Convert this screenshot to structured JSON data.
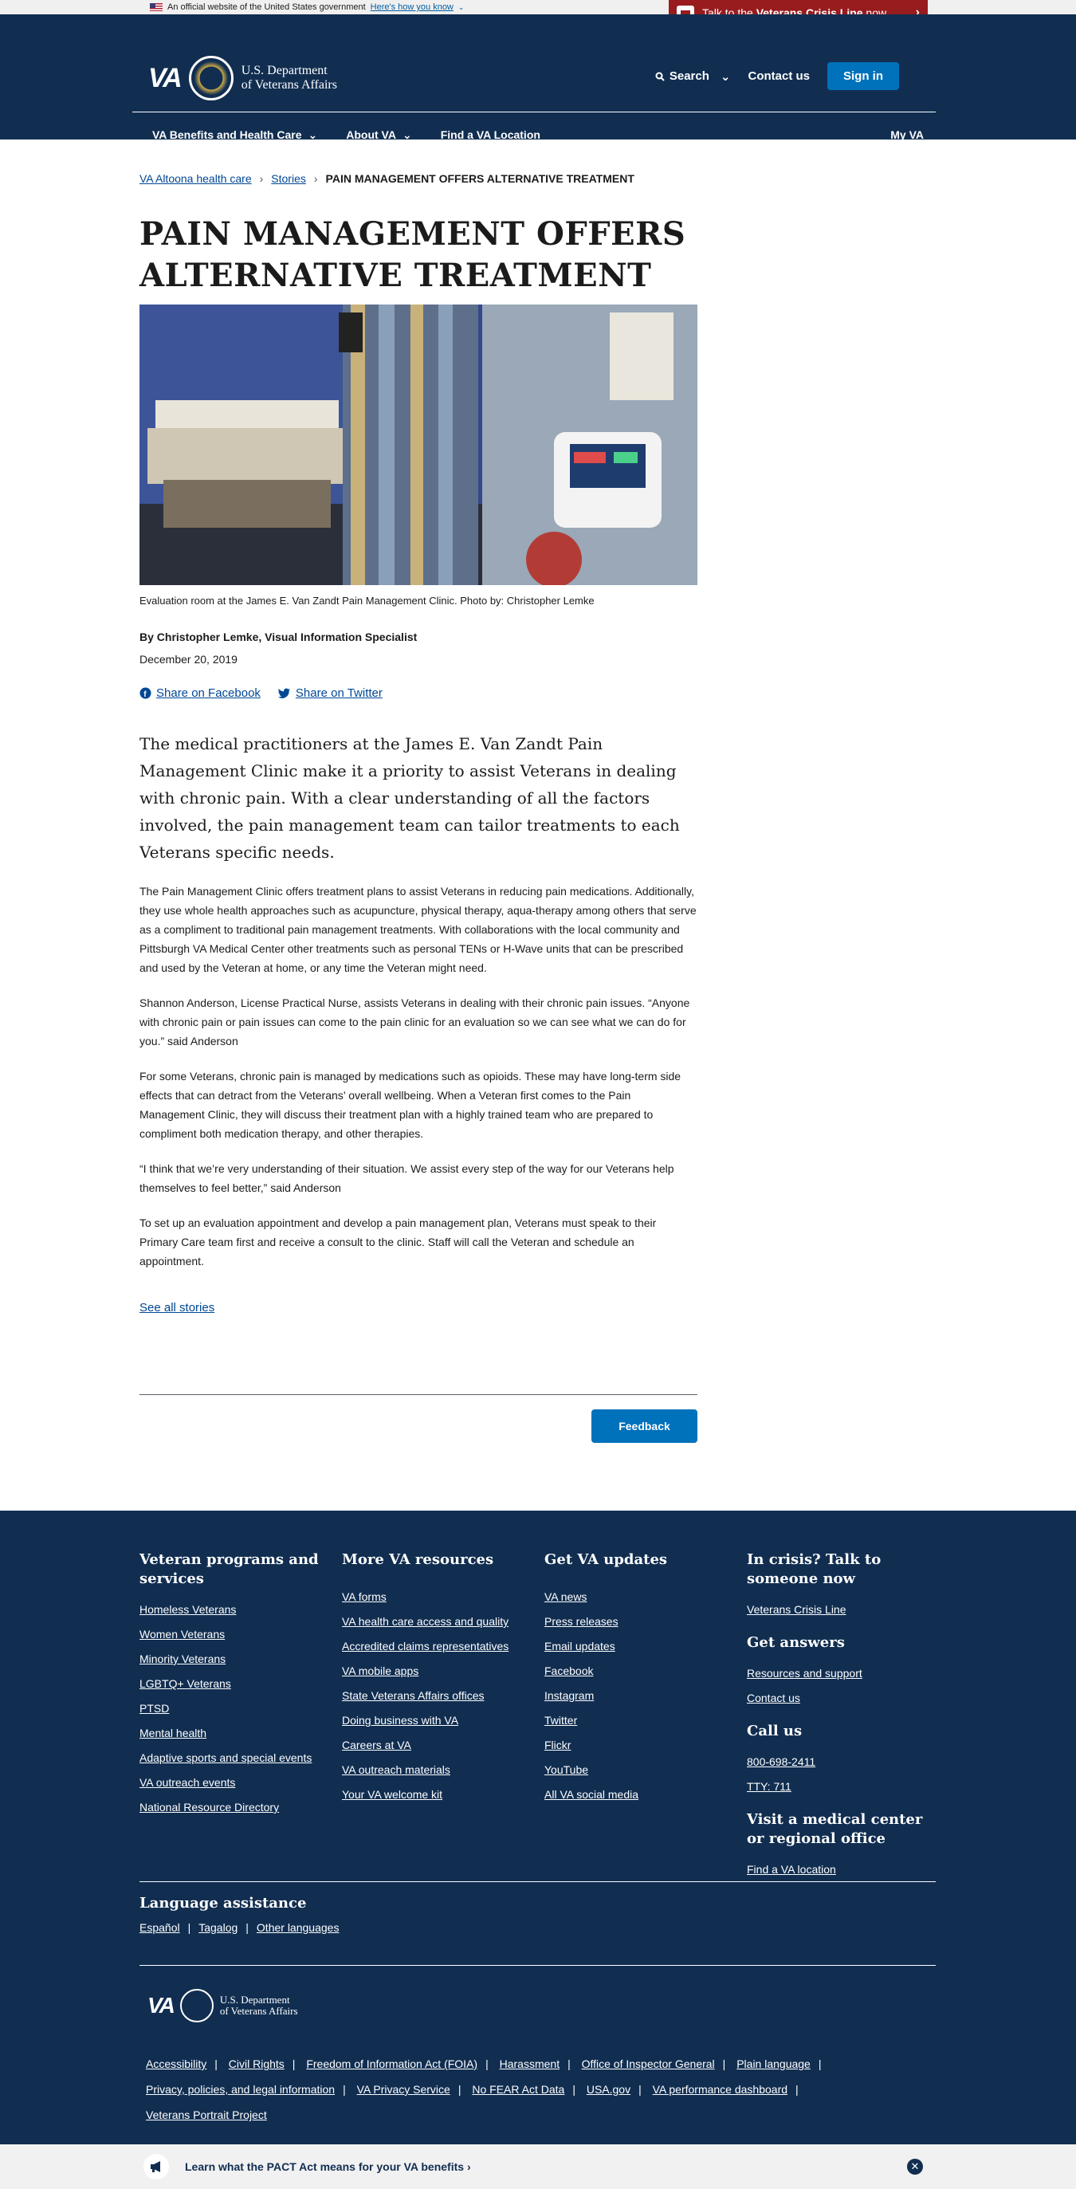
{
  "official_banner": {
    "text": "An official website of the United States government",
    "link": "Here's how you know"
  },
  "crisis_line": {
    "prefix": "Talk to the ",
    "strong": "Veterans Crisis Line",
    "suffix": " now"
  },
  "header": {
    "logo_text": "VA",
    "dept_line1": "U.S. Department",
    "dept_line2": "of Veterans Affairs",
    "search": "Search",
    "contact": "Contact us",
    "signin": "Sign in",
    "nav": [
      "VA Benefits and Health Care",
      "About VA",
      "Find a VA Location"
    ],
    "my_va": "My VA"
  },
  "breadcrumb": {
    "items": [
      "VA Altoona health care",
      "Stories"
    ],
    "current": "PAIN MANAGEMENT OFFERS ALTERNATIVE TREATMENT"
  },
  "article": {
    "title_line1": "PAIN MANAGEMENT OFFERS",
    "title_line2": "ALTERNATIVE TREATMENT",
    "caption": "Evaluation room at the James E. Van Zandt Pain Management Clinic. Photo by: Christopher Lemke",
    "byline": "By Christopher Lemke, Visual Information Specialist",
    "date": "December 20, 2019",
    "share_facebook": "Share on Facebook",
    "share_twitter": "Share on Twitter",
    "intro": "The medical practitioners at the James E. Van Zandt Pain Management Clinic make it a priority to assist Veterans in dealing with chronic pain. With a clear understanding of all the factors involved, the pain management team can tailor treatments to each Veterans specific needs.",
    "paragraphs": [
      "The Pain Management Clinic offers treatment plans to assist Veterans in reducing pain medications. Additionally, they use whole health approaches such as acupuncture, physical therapy, aqua-therapy among others that serve as a compliment to traditional pain management treatments. With collaborations with the local community and Pittsburgh VA Medical Center other treatments such as personal TENs or H-Wave units that can be prescribed and used by the Veteran at home, or any time the Veteran might need.",
      "Shannon Anderson, License Practical Nurse, assists Veterans in dealing with their chronic pain issues. “Anyone with chronic pain or pain issues can come to the pain clinic for an evaluation so we can see what we can do for you.” said Anderson",
      "For some Veterans, chronic pain is managed by medications such as opioids. These may have long-term side effects that can detract from the Veterans’ overall wellbeing. When a Veteran first comes to the Pain Management Clinic, they will discuss their treatment plan with a highly trained team who are prepared to compliment both medication therapy, and other therapies.",
      "“I think that we’re very understanding of their situation. We assist every step of the way for our Veterans help themselves to feel better,” said Anderson",
      "To set up an evaluation appointment and develop a pain management plan, Veterans must speak to their Primary Care team first and receive a consult to the clinic. Staff will call the Veteran and schedule an appointment."
    ],
    "see_all": "See all stories",
    "feedback": "Feedback"
  },
  "footer": {
    "col1": {
      "title": "Veteran programs and services",
      "links": [
        "Homeless Veterans",
        "Women Veterans",
        "Minority Veterans",
        "LGBTQ+ Veterans",
        "PTSD",
        "Mental health",
        "Adaptive sports and special events",
        "VA outreach events",
        "National Resource Directory"
      ]
    },
    "col2": {
      "title": "More VA resources",
      "links": [
        "VA forms",
        "VA health care access and quality",
        "Accredited claims representatives",
        "VA mobile apps",
        "State Veterans Affairs offices",
        "Doing business with VA",
        "Careers at VA",
        "VA outreach materials",
        "Your VA welcome kit"
      ]
    },
    "col3": {
      "title": "Get VA updates",
      "links": [
        "VA news",
        "Press releases",
        "Email updates",
        "Facebook",
        "Instagram",
        "Twitter",
        "Flickr",
        "YouTube",
        "All VA social media"
      ]
    },
    "col4": {
      "crisis_title": "In crisis? Talk to someone now",
      "crisis_link": "Veterans Crisis Line",
      "answers_title": "Get answers",
      "answers_links": [
        "Resources and support",
        "Contact us"
      ],
      "call_title": "Call us",
      "phone": "800-698-2411",
      "tty": "TTY: 711",
      "visit_title": "Visit a medical center or regional office",
      "visit_link": "Find a VA location"
    },
    "language": {
      "title": "Language assistance",
      "links": [
        "Español",
        "Tagalog",
        "Other languages"
      ]
    },
    "logo_text": "VA",
    "dept_line1": "U.S. Department",
    "dept_line2": "of Veterans Affairs",
    "legal_row1": [
      "Accessibility",
      "Civil Rights",
      "Freedom of Information Act (FOIA)",
      "Harassment",
      "Office of Inspector General",
      "Plain language"
    ],
    "legal_row2": [
      "Privacy, policies, and legal information",
      "VA Privacy Service",
      "No FEAR Act Data",
      "USA.gov",
      "VA performance dashboard"
    ],
    "legal_row3": [
      "Veterans Portrait Project"
    ]
  },
  "pact_banner": {
    "text": "Learn what the PACT Act means for your VA benefits ›"
  }
}
